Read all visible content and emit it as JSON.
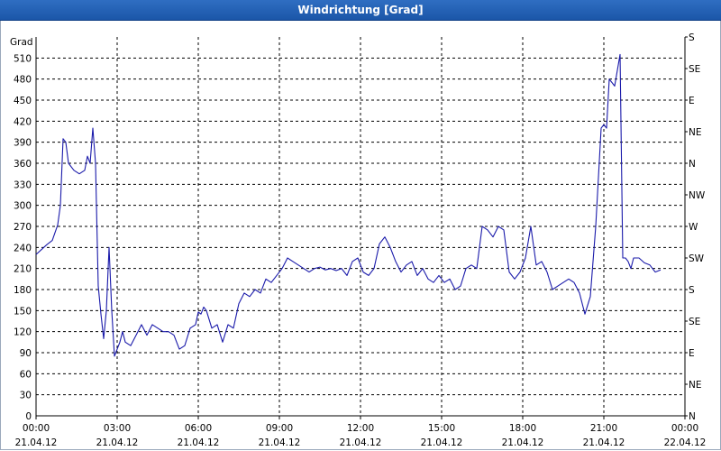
{
  "window": {
    "title": "Windrichtung [Grad]"
  },
  "chart_data": {
    "type": "line",
    "title": "Windrichtung [Grad]",
    "ylabel": "Grad",
    "ylim": [
      0,
      540
    ],
    "xlim": [
      "21.04.12 00:00",
      "22.04.12 00:00"
    ],
    "grid": true,
    "yticks": [
      0,
      30,
      60,
      90,
      120,
      150,
      180,
      210,
      240,
      270,
      300,
      330,
      360,
      390,
      420,
      450,
      480,
      510
    ],
    "right_axis": [
      {
        "value": 0,
        "label": "N"
      },
      {
        "value": 45,
        "label": "NE"
      },
      {
        "value": 90,
        "label": "E"
      },
      {
        "value": 135,
        "label": "SE"
      },
      {
        "value": 180,
        "label": "S"
      },
      {
        "value": 225,
        "label": "SW"
      },
      {
        "value": 270,
        "label": "W"
      },
      {
        "value": 315,
        "label": "NW"
      },
      {
        "value": 360,
        "label": "N"
      },
      {
        "value": 405,
        "label": "NE"
      },
      {
        "value": 450,
        "label": "E"
      },
      {
        "value": 495,
        "label": "SE"
      },
      {
        "value": 540,
        "label": "S"
      }
    ],
    "xticks": [
      {
        "time": "00:00",
        "date": "21.04.12"
      },
      {
        "time": "03:00",
        "date": "21.04.12"
      },
      {
        "time": "06:00",
        "date": "21.04.12"
      },
      {
        "time": "09:00",
        "date": "21.04.12"
      },
      {
        "time": "12:00",
        "date": "21.04.12"
      },
      {
        "time": "15:00",
        "date": "21.04.12"
      },
      {
        "time": "18:00",
        "date": "21.04.12"
      },
      {
        "time": "21:00",
        "date": "21.04.12"
      },
      {
        "time": "00:00",
        "date": "22.04.12"
      }
    ],
    "series": [
      {
        "color": "#1a1aaa",
        "x_hours": [
          0,
          0.2,
          0.4,
          0.6,
          0.8,
          0.9,
          1.0,
          1.1,
          1.2,
          1.4,
          1.6,
          1.8,
          1.9,
          2.0,
          2.1,
          2.2,
          2.3,
          2.4,
          2.5,
          2.6,
          2.7,
          2.8,
          2.9,
          3.0,
          3.1,
          3.2,
          3.3,
          3.5,
          3.7,
          3.9,
          4.1,
          4.3,
          4.5,
          4.7,
          4.9,
          5.1,
          5.3,
          5.5,
          5.7,
          5.9,
          6.0,
          6.1,
          6.2,
          6.3,
          6.5,
          6.7,
          6.9,
          7.1,
          7.3,
          7.5,
          7.7,
          7.9,
          8.1,
          8.3,
          8.5,
          8.7,
          8.9,
          9.1,
          9.3,
          9.5,
          9.7,
          9.9,
          10.1,
          10.3,
          10.5,
          10.7,
          10.9,
          11.1,
          11.3,
          11.5,
          11.7,
          11.9,
          12.1,
          12.3,
          12.5,
          12.7,
          12.9,
          13.1,
          13.3,
          13.5,
          13.7,
          13.9,
          14.1,
          14.3,
          14.5,
          14.7,
          14.9,
          15.1,
          15.3,
          15.5,
          15.7,
          15.9,
          16.1,
          16.3,
          16.5,
          16.7,
          16.9,
          17.1,
          17.3,
          17.5,
          17.7,
          17.9,
          18.1,
          18.3,
          18.5,
          18.7,
          18.9,
          19.1,
          19.3,
          19.5,
          19.7,
          19.9,
          20.1,
          20.3,
          20.5,
          20.7,
          20.9,
          21.0,
          21.1,
          21.2,
          21.4,
          21.6,
          21.7,
          21.8,
          21.9,
          22.0,
          22.1,
          22.3,
          22.5,
          22.7,
          22.9,
          23.1,
          23.3,
          23.5,
          23.7,
          23.8,
          24.0
        ],
        "values": [
          230,
          237,
          244,
          250,
          272,
          300,
          395,
          390,
          360,
          350,
          345,
          350,
          370,
          360,
          410,
          360,
          185,
          145,
          110,
          150,
          240,
          150,
          85,
          95,
          105,
          120,
          105,
          100,
          115,
          130,
          115,
          130,
          125,
          120,
          120,
          115,
          95,
          100,
          125,
          130,
          148,
          145,
          155,
          150,
          125,
          130,
          105,
          130,
          125,
          160,
          175,
          170,
          180,
          175,
          195,
          190,
          200,
          210,
          225,
          220,
          215,
          210,
          205,
          210,
          212,
          208,
          210,
          207,
          210,
          200,
          220,
          225,
          205,
          200,
          210,
          245,
          255,
          240,
          220,
          205,
          215,
          220,
          200,
          210,
          195,
          190,
          200,
          190,
          195,
          180,
          185,
          210,
          215,
          210,
          270,
          265,
          255,
          270,
          265,
          205,
          195,
          205,
          225,
          270,
          215,
          220,
          205,
          180,
          185,
          190,
          195,
          190,
          175,
          145,
          170,
          270,
          410,
          415,
          410,
          480,
          470,
          515,
          225,
          225,
          220,
          210,
          225,
          225,
          218,
          215,
          205,
          208
        ]
      }
    ]
  }
}
